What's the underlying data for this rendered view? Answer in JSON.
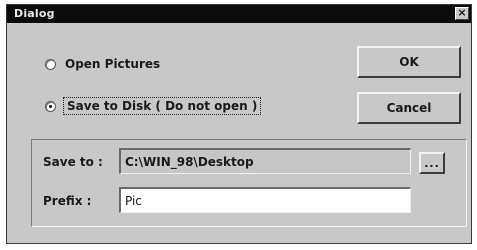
{
  "window": {
    "title": "Dialog",
    "close_glyph": "×"
  },
  "options": {
    "open_pictures": {
      "label": "Open Pictures",
      "checked": false
    },
    "save_to_disk": {
      "label": "Save to Disk ( Do not open )",
      "checked": true
    }
  },
  "buttons": {
    "ok_label": "OK",
    "cancel_label": "Cancel",
    "browse_label": "..."
  },
  "fields": {
    "save_to_label": "Save to :",
    "save_to_value": "C:\\WIN_98\\Desktop",
    "prefix_label": "Prefix :",
    "prefix_value": "Pic"
  },
  "icons": {
    "close": "close-icon",
    "radio": "radio-button-icon"
  }
}
